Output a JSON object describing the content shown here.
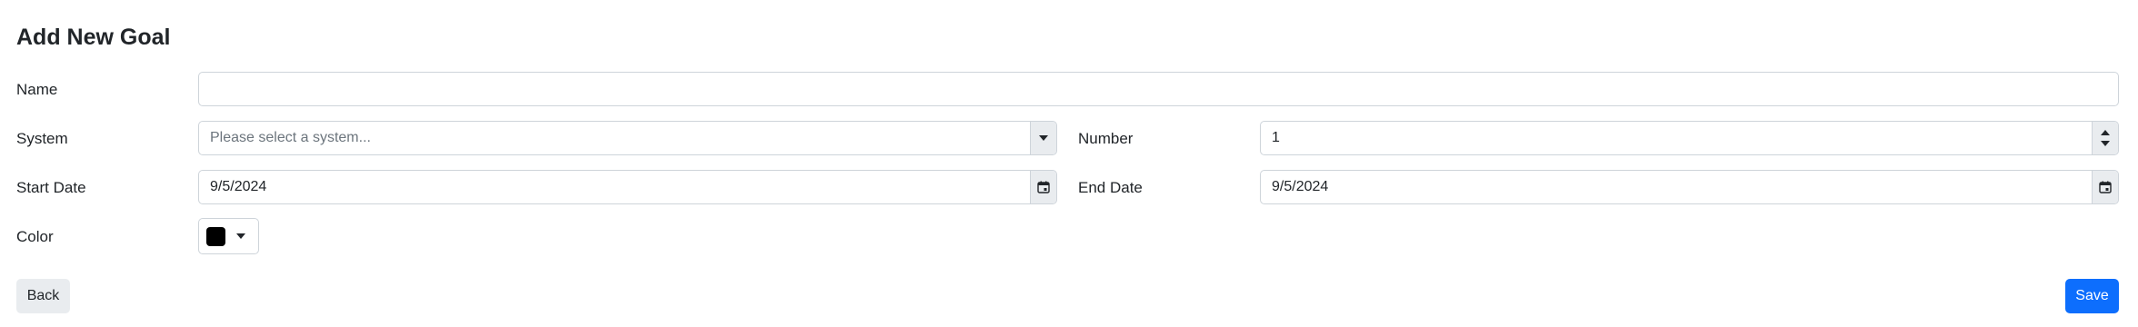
{
  "form": {
    "title": "Add New Goal",
    "name": {
      "label": "Name",
      "value": ""
    },
    "system": {
      "label": "System",
      "placeholder": "Please select a system..."
    },
    "number": {
      "label": "Number",
      "value": "1"
    },
    "start_date": {
      "label": "Start Date",
      "value": "9/5/2024"
    },
    "end_date": {
      "label": "End Date",
      "value": "9/5/2024"
    },
    "color": {
      "label": "Color",
      "value": "#000000"
    }
  },
  "actions": {
    "back_label": "Back",
    "save_label": "Save",
    "save_color": "#0d6efd"
  },
  "icons": {
    "dropdown": "chevron-down-icon",
    "calendar": "calendar-icon",
    "spinner": "number-spinner-icon"
  }
}
